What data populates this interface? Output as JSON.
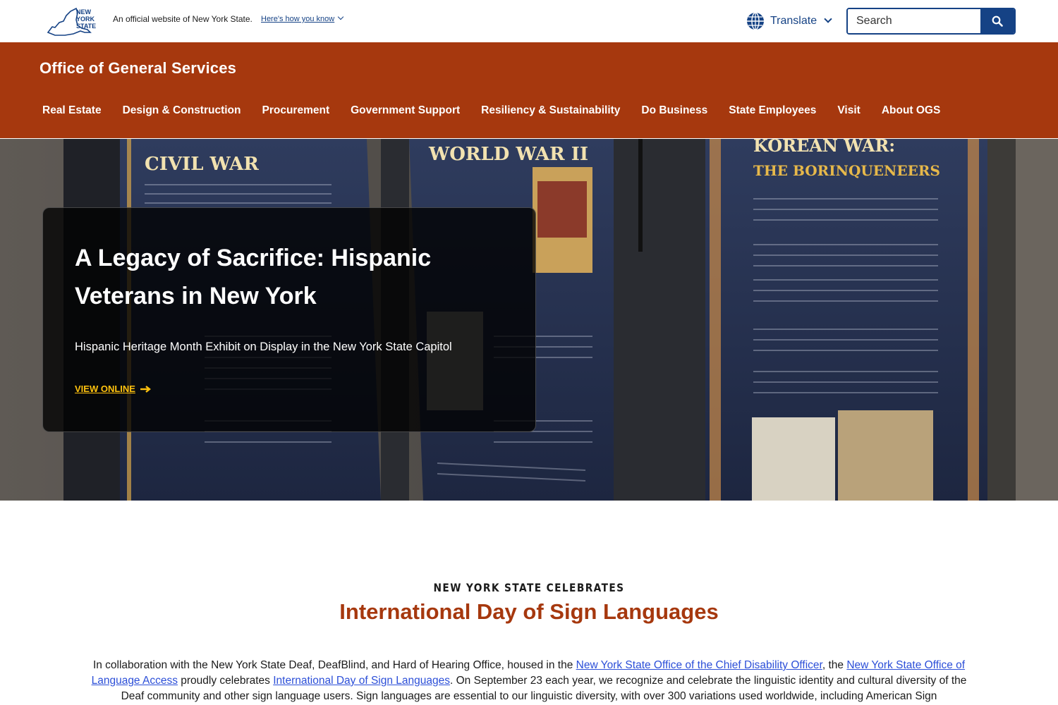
{
  "universal_bar": {
    "logo_text": "NEW YORK STATE",
    "official_text": "An official website of New York State.",
    "how_you_know": "Here's how you know",
    "translate_label": "Translate",
    "search_placeholder": "Search"
  },
  "agency": {
    "title": "Office of General Services",
    "nav": [
      {
        "label": "Real Estate"
      },
      {
        "label": "Design & Construction"
      },
      {
        "label": "Procurement"
      },
      {
        "label": "Government Support"
      },
      {
        "label": "Resiliency & Sustainability"
      },
      {
        "label": "Do Business"
      },
      {
        "label": "State Employees"
      },
      {
        "label": "Visit"
      },
      {
        "label": "About OGS"
      }
    ]
  },
  "hero": {
    "title": "A Legacy of Sacrifice: Hispanic Veterans in New York",
    "subtitle": "Hispanic Heritage Month Exhibit on Display in the New York State Capitol",
    "cta": "VIEW ONLINE",
    "photo_panels": [
      "CIVIL WAR",
      "WORLD WAR II",
      "KOREAN WAR:",
      "THE BORINQUENEERS"
    ]
  },
  "section": {
    "eyebrow": "NEW YORK STATE CELEBRATES",
    "title": "International Day of Sign Languages",
    "body": {
      "t1": "In collaboration with the New York State Deaf, DeafBlind, and Hard of Hearing Office, housed in the ",
      "link1": "New York State Office of the Chief Disability Officer",
      "t2": ", the ",
      "link2": "New York State Office of Language Access",
      "t3": " proudly celebrates ",
      "link3": "International Day of Sign Languages",
      "t4": ". On September 23 each year, we recognize and celebrate the linguistic identity and cultural diversity of the Deaf community and other sign language users. Sign languages are essential to our linguistic diversity, with over 300 variations used worldwide, including American Sign"
    }
  },
  "colors": {
    "brand_orange": "#a6380e",
    "nys_blue": "#154285",
    "cta_yellow": "#ffc20e",
    "link_blue": "#2c4fd8"
  },
  "icons": {
    "logo": "nys-map-logo-icon",
    "globe": "globe-icon",
    "search": "search-icon",
    "arrow": "arrow-right-icon",
    "chevron": "chevron-down-icon"
  }
}
